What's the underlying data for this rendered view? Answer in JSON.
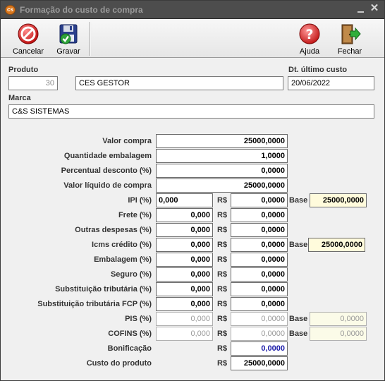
{
  "window": {
    "title": "Formação do custo de compra",
    "minimize_icon": "minimize-icon",
    "close_glyph": "✕"
  },
  "toolbar": {
    "cancel_label": "Cancelar",
    "save_label": "Gravar",
    "help_label": "Ajuda",
    "close_label": "Fechar"
  },
  "header": {
    "produto_label": "Produto",
    "produto_code": "30",
    "produto_name": "CES GESTOR",
    "dt_label": "Dt. último custo",
    "dt_value": "20/06/2022",
    "marca_label": "Marca",
    "marca_value": "C&S SISTEMAS"
  },
  "currency": "R$",
  "base_label": "Base",
  "rows": {
    "valor_compra": {
      "label": "Valor compra",
      "value": "25000,0000"
    },
    "qtd_embalagem": {
      "label": "Quantidade embalagem",
      "value": "1,0000"
    },
    "perc_desconto": {
      "label": "Percentual desconto (%)",
      "value": "0,0000"
    },
    "valor_liquido": {
      "label": "Valor líquido de compra",
      "value": "25000,0000"
    },
    "ipi": {
      "label": "IPI (%)",
      "pct": "0,000",
      "value": "0,0000",
      "base": "25000,0000"
    },
    "frete": {
      "label": "Frete (%)",
      "pct": "0,000",
      "value": "0,0000"
    },
    "outras": {
      "label": "Outras despesas (%)",
      "pct": "0,000",
      "value": "0,0000"
    },
    "icms": {
      "label": "Icms crédito (%)",
      "pct": "0,000",
      "value": "0,0000",
      "base": "25000,0000"
    },
    "embalagem": {
      "label": "Embalagem (%)",
      "pct": "0,000",
      "value": "0,0000"
    },
    "seguro": {
      "label": "Seguro (%)",
      "pct": "0,000",
      "value": "0,0000"
    },
    "st": {
      "label": "Substituição tributária (%)",
      "pct": "0,000",
      "value": "0,0000"
    },
    "st_fcp": {
      "label": "Substituição tributária FCP (%)",
      "pct": "0,000",
      "value": "0,0000"
    },
    "pis": {
      "label": "PIS (%)",
      "pct": "0,000",
      "value": "0,0000",
      "base": "0,0000"
    },
    "cofins": {
      "label": "COFINS (%)",
      "pct": "0,000",
      "value": "0,0000",
      "base": "0,0000"
    },
    "bonificacao": {
      "label": "Bonificação",
      "value": "0,0000"
    },
    "custo": {
      "label": "Custo do produto",
      "value": "25000,0000"
    }
  },
  "colors": {
    "titlebar": "#4d4d4d",
    "base_bg": "#fffbdc",
    "bonus_text": "#1a1aa8"
  }
}
